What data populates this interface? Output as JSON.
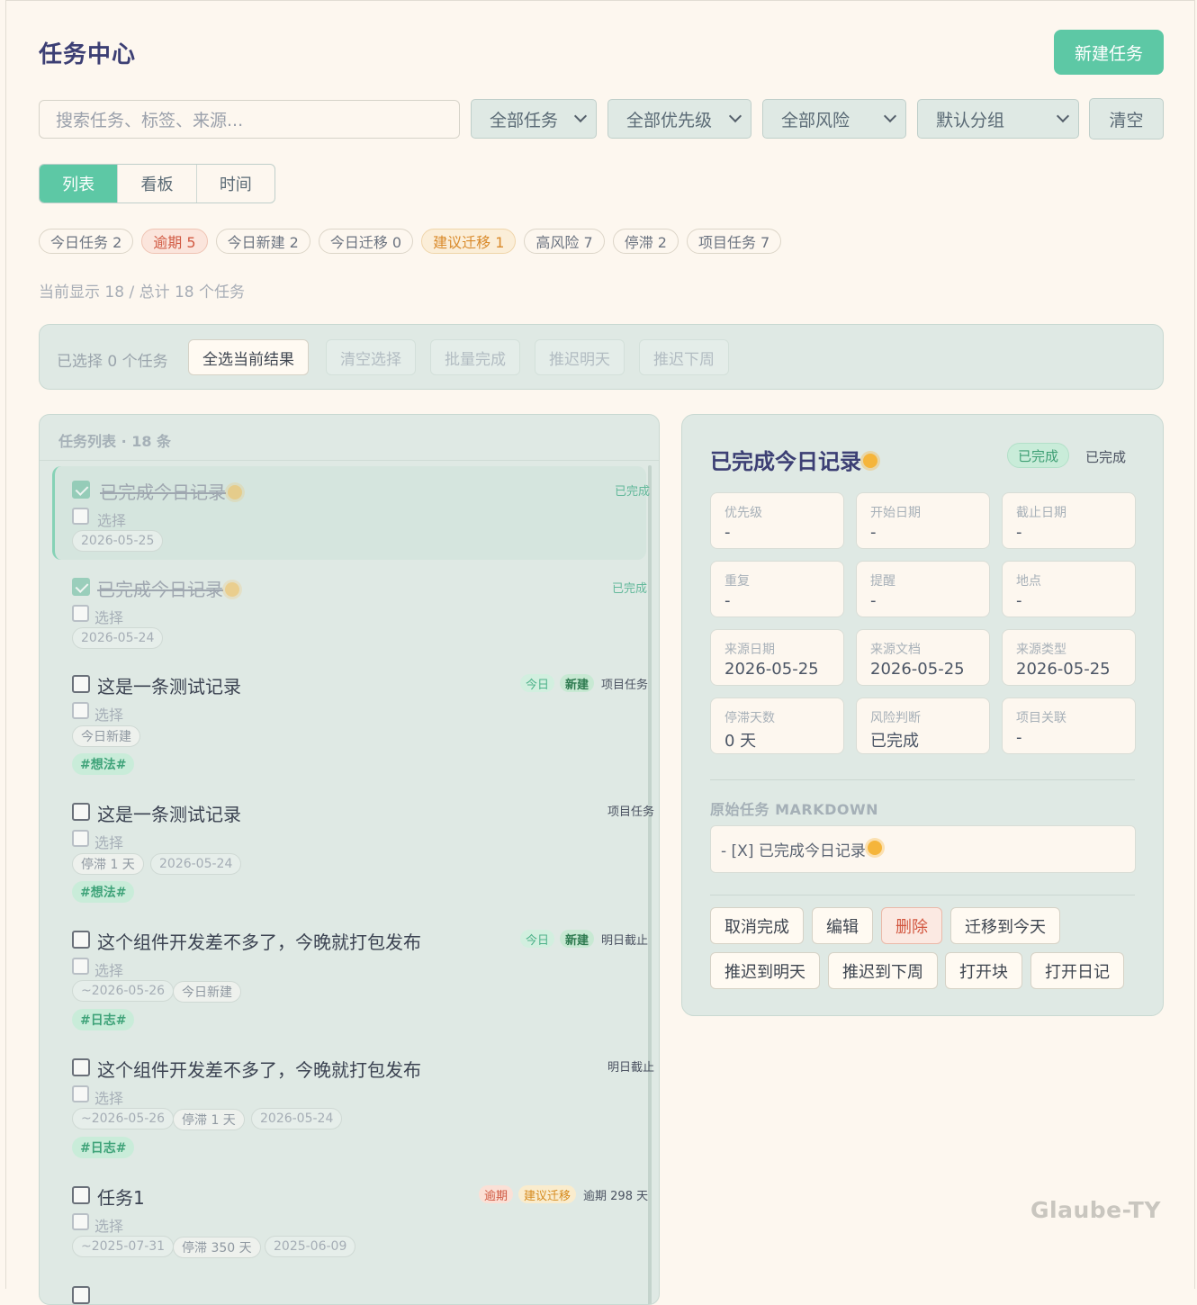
{
  "header": {
    "title": "任务中心",
    "new_task_label": "新建任务"
  },
  "filters": {
    "search_placeholder": "搜索任务、标签、来源...",
    "task_scope": "全部任务",
    "priority": "全部优先级",
    "risk": "全部风险",
    "grouping": "默认分组",
    "clear_label": "清空"
  },
  "view_tabs": [
    "列表",
    "看板",
    "时间"
  ],
  "quick_filters": [
    {
      "label": "今日任务 2",
      "tone": "plain"
    },
    {
      "label": "逾期 5",
      "tone": "red"
    },
    {
      "label": "今日新建 2",
      "tone": "plain"
    },
    {
      "label": "今日迁移 0",
      "tone": "plain"
    },
    {
      "label": "建议迁移 1",
      "tone": "orange"
    },
    {
      "label": "高风险 7",
      "tone": "plain"
    },
    {
      "label": "停滞 2",
      "tone": "plain"
    },
    {
      "label": "项目任务 7",
      "tone": "plain"
    }
  ],
  "count_text": "当前显示 18 / 总计 18 个任务",
  "bulk": {
    "selected_text": "已选择 0 个任务",
    "select_all": "全选当前结果",
    "clear_selection": "清空选择",
    "batch_complete": "批量完成",
    "postpone_tomorrow": "推迟明天",
    "postpone_next_week": "推迟下周"
  },
  "list": {
    "header": "任务列表 · 18 条",
    "select_label": "选择",
    "tasks": [
      {
        "title": "已完成今日记录",
        "right": "已完成",
        "pills": [
          "2026-05-25"
        ]
      },
      {
        "title": "已完成今日记录",
        "right": "已完成",
        "pills": [
          "2026-05-24"
        ]
      },
      {
        "title": "这是一条测试记录",
        "badge1": "今日",
        "badge2": "新建",
        "right": "项目任务",
        "pills": [
          "今日新建"
        ],
        "tag": "#想法#"
      },
      {
        "title": "这是一条测试记录",
        "right": "项目任务",
        "pills": [
          "停滞 1 天",
          "2026-05-24"
        ],
        "tag": "#想法#"
      },
      {
        "title": "这个组件开发差不多了，今晚就打包发布",
        "badge1": "今日",
        "badge2": "新建",
        "right": "明日截止",
        "pills": [
          "~2026-05-26",
          "今日新建"
        ],
        "tag": "#日志#"
      },
      {
        "title": "这个组件开发差不多了，今晚就打包发布",
        "right": "明日截止",
        "pills": [
          "~2026-05-26",
          "停滞 1 天",
          "2026-05-24"
        ],
        "tag": "#日志#"
      },
      {
        "title": "任务1",
        "badge1": "逾期",
        "badge2": "建议迁移",
        "right": "逾期 298 天",
        "pills": [
          "~2025-07-31",
          "停滞 350 天",
          "2025-06-09"
        ]
      }
    ]
  },
  "detail": {
    "title": "已完成今日记录",
    "badge": "已完成",
    "status": "已完成",
    "fields": [
      {
        "label": "优先级",
        "value": "-"
      },
      {
        "label": "开始日期",
        "value": "-"
      },
      {
        "label": "截止日期",
        "value": "-"
      },
      {
        "label": "重复",
        "value": "-"
      },
      {
        "label": "提醒",
        "value": "-"
      },
      {
        "label": "地点",
        "value": "-"
      },
      {
        "label": "来源日期",
        "value": "2026-05-25"
      },
      {
        "label": "来源文档",
        "value": "2026-05-25"
      },
      {
        "label": "来源类型",
        "value": "2026-05-25"
      },
      {
        "label": "停滞天数",
        "value": "0 天"
      },
      {
        "label": "风险判断",
        "value": "已完成"
      },
      {
        "label": "项目关联",
        "value": "-"
      }
    ],
    "markdown_label": "原始任务 MARKDOWN",
    "markdown": "- [X] 已完成今日记录",
    "actions": {
      "uncomplete": "取消完成",
      "edit": "编辑",
      "delete": "删除",
      "migrate_today": "迁移到今天",
      "postpone_tomorrow": "推迟到明天",
      "postpone_next_week": "推迟到下周",
      "open_block": "打开块",
      "open_diary": "打开日记"
    }
  },
  "watermark": "Glaube-TY",
  "icons": {
    "chevron": "chevron-down-icon",
    "sun": "sun-emoji-icon",
    "checkbox": "checkbox-icon"
  }
}
